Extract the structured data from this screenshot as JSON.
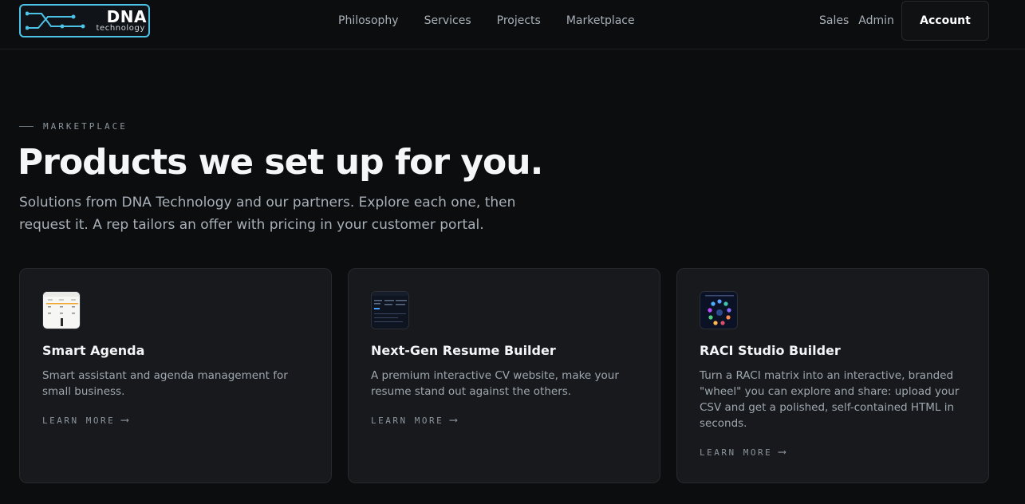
{
  "brand": {
    "name": "DNA",
    "sub": "technology",
    "accent": "#4cc3e6"
  },
  "nav": {
    "items": [
      "Philosophy",
      "Services",
      "Projects",
      "Marketplace"
    ]
  },
  "right_nav": {
    "sales": "Sales",
    "admin": "Admin",
    "account": "Account"
  },
  "hero": {
    "eyebrow": "MARKETPLACE",
    "title": "Products we set up for you.",
    "subtitle": "Solutions from DNA Technology and our partners. Explore each one, then request it. A rep tailors an offer with pricing in your customer portal."
  },
  "cards": [
    {
      "title": "Smart Agenda",
      "description": "Smart assistant and agenda management for small business.",
      "cta": "LEARN MORE",
      "icon": "smart-agenda-thumbnail"
    },
    {
      "title": "Next-Gen Resume Builder",
      "description": "A premium interactive CV website, make your resume stand out against the others.",
      "cta": "LEARN MORE",
      "icon": "resume-builder-thumbnail"
    },
    {
      "title": "RACI Studio Builder",
      "description": "Turn a RACI matrix into an interactive, branded \"wheel\" you can explore and share: upload your CSV and get a polished, self-contained HTML in seconds.",
      "cta": "LEARN MORE",
      "icon": "raci-wheel-thumbnail"
    }
  ]
}
